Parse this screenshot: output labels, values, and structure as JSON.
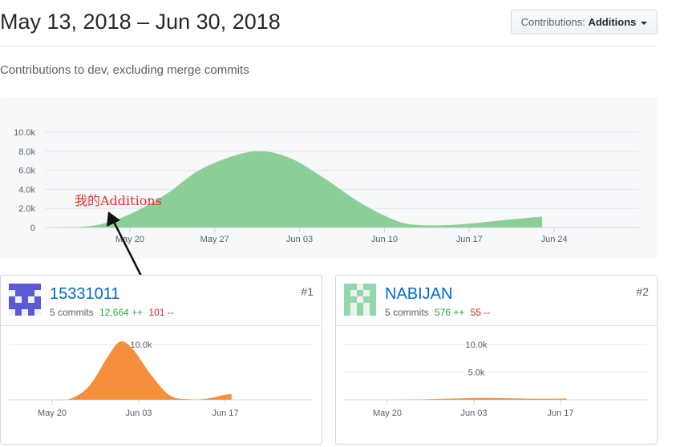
{
  "header": {
    "date_range": "May 13, 2018 – Jun 30, 2018",
    "contrib_key": "Contributions:",
    "contrib_value": "Additions"
  },
  "subtitle": "Contributions to dev, excluding merge commits",
  "annotation": "我的Additions",
  "chart_data": [
    {
      "type": "area",
      "series": [
        {
          "values": [
            [
              0,
              0
            ],
            [
              4,
              200
            ],
            [
              7,
              1400
            ],
            [
              10,
              3500
            ],
            [
              13,
              6200
            ],
            [
              17,
              7950
            ],
            [
              20,
              7400
            ],
            [
              23,
              5200
            ],
            [
              26,
              2600
            ],
            [
              29,
              700
            ],
            [
              31,
              250
            ],
            [
              34,
              300
            ],
            [
              38,
              800
            ],
            [
              41,
              1150
            ]
          ]
        }
      ],
      "x_ticks": [
        "May 20",
        "May 27",
        "Jun 03",
        "Jun 10",
        "Jun 17",
        "Jun 24"
      ],
      "y_ticks": [
        "0",
        "2.0k",
        "4.0k",
        "6.0k",
        "8.0k",
        "10.0k"
      ],
      "ylim": [
        0,
        10000
      ],
      "color": "#8cce98"
    },
    {
      "type": "area",
      "series": [
        {
          "values": [
            [
              0,
              0
            ],
            [
              3,
              200
            ],
            [
              6,
              2500
            ],
            [
              9,
              7800
            ],
            [
              11,
              10500
            ],
            [
              13,
              9200
            ],
            [
              16,
              4500
            ],
            [
              19,
              800
            ],
            [
              22,
              100
            ],
            [
              25,
              200
            ],
            [
              28,
              900
            ],
            [
              29,
              1000
            ]
          ]
        }
      ],
      "x_ticks": [
        "May 20",
        "Jun 03",
        "Jun 17"
      ],
      "y_ticks": [
        "10.0k"
      ],
      "ylim": [
        0,
        10000
      ],
      "color": "#f58f3b"
    },
    {
      "type": "area",
      "series": [
        {
          "values": [
            [
              0,
              0
            ],
            [
              5,
              60
            ],
            [
              10,
              200
            ],
            [
              15,
              320
            ],
            [
              20,
              260
            ],
            [
              25,
              180
            ],
            [
              29,
              220
            ]
          ]
        }
      ],
      "x_ticks": [
        "May 20",
        "Jun 03",
        "Jun 17"
      ],
      "y_ticks": [
        "5.0k",
        "10.0k"
      ],
      "ylim": [
        0,
        10000
      ],
      "color": "#f58f3b"
    }
  ],
  "contributors": [
    {
      "name": "15331011",
      "commits": "5 commits",
      "additions": "12,664 ++",
      "deletions": "101 --",
      "rank": "#1",
      "avatar_color": "#5a5ad6"
    },
    {
      "name": "NABIJAN",
      "commits": "5 commits",
      "additions": "576 ++",
      "deletions": "55 --",
      "rank": "#2",
      "avatar_color": "#8fd9a8"
    }
  ]
}
